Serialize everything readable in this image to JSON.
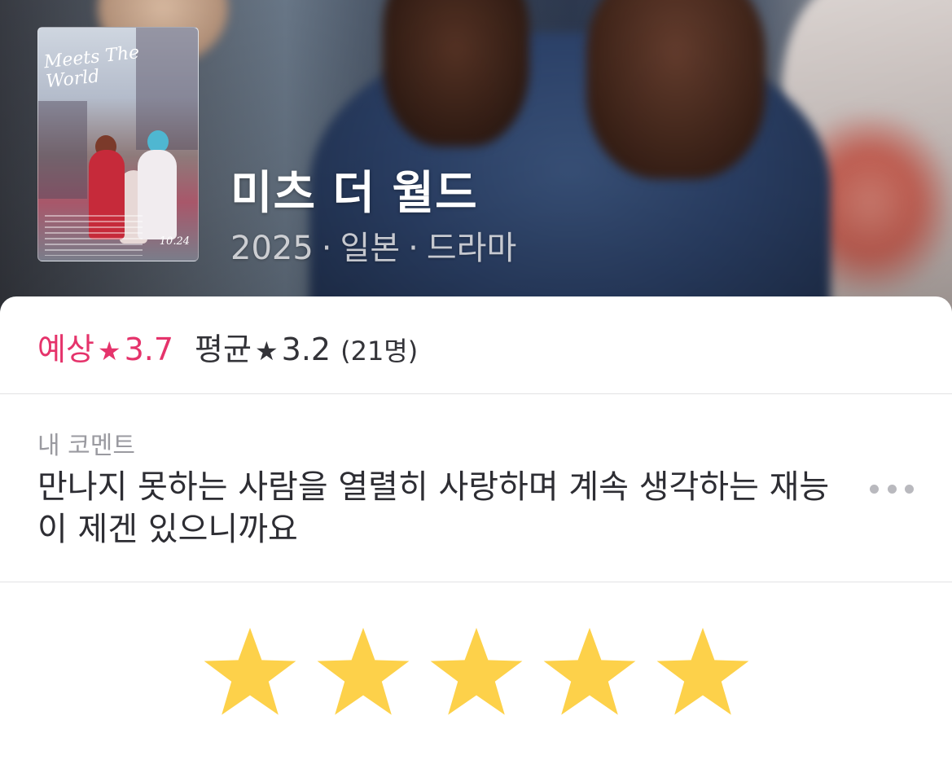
{
  "movie": {
    "title": "미츠 더 월드",
    "year": "2025",
    "country": "일본",
    "genre": "드라마",
    "separator": "·",
    "poster": {
      "title_art": "Meets The World",
      "date_text": "10.24"
    }
  },
  "ratings": {
    "expected_label": "예상",
    "expected_value": "3.7",
    "average_label": "평균",
    "average_value": "3.2",
    "count_text": "(21명)",
    "star_glyph": "★",
    "expected_color": "#e5336b"
  },
  "comment": {
    "label": "내 코멘트",
    "text": "만나지 못하는 사람을 열렬히 사랑하며 계속 생각하는 재능이 제겐 있으니까요",
    "more_icon": "more-horizontal-icon"
  },
  "my_rating": {
    "stars_filled": 5,
    "stars_total": 5,
    "star_color": "#fdd14a"
  }
}
